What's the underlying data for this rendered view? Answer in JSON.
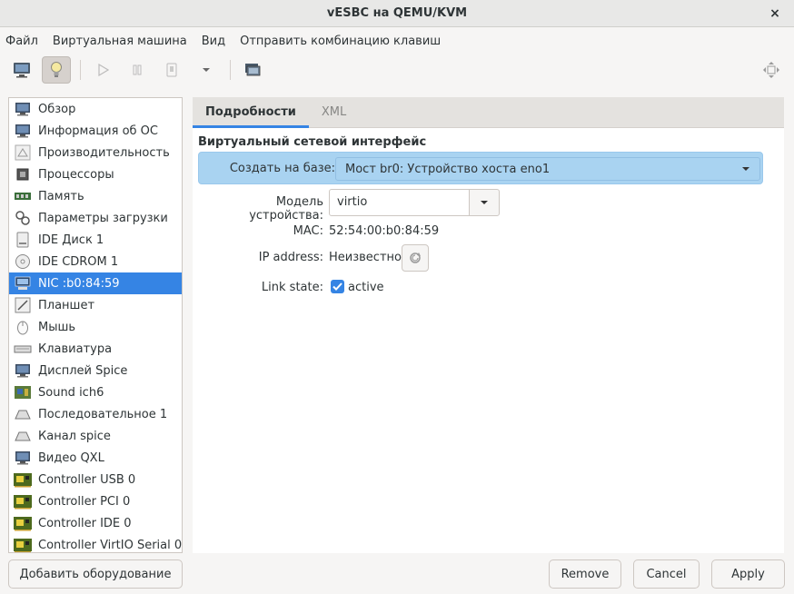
{
  "window": {
    "title": "vESBC на QEMU/KVM",
    "close_glyph": "×"
  },
  "menubar": [
    "Файл",
    "Виртуальная машина",
    "Вид",
    "Отправить комбинацию клавиш"
  ],
  "toolbar": {
    "buttons": [
      "console-icon",
      "details-icon",
      "play-icon",
      "pause-icon",
      "stop-icon",
      "dropdown-arrow-icon",
      "snapshot-icon"
    ],
    "right_button": "fullscreen-icon"
  },
  "hardware_list": [
    {
      "label": "Обзор",
      "icon": "monitor-icon"
    },
    {
      "label": "Информация об ОС",
      "icon": "monitor-icon"
    },
    {
      "label": "Производительность",
      "icon": "chart-icon"
    },
    {
      "label": "Процессоры",
      "icon": "cpu-icon"
    },
    {
      "label": "Память",
      "icon": "memory-icon"
    },
    {
      "label": "Параметры загрузки",
      "icon": "gears-icon"
    },
    {
      "label": "IDE Диск 1",
      "icon": "disk-icon"
    },
    {
      "label": "IDE CDROM 1",
      "icon": "cdrom-icon"
    },
    {
      "label": "NIC :b0:84:59",
      "icon": "network-icon"
    },
    {
      "label": "Планшет",
      "icon": "tablet-icon"
    },
    {
      "label": "Мышь",
      "icon": "mouse-icon"
    },
    {
      "label": "Клавиатура",
      "icon": "keyboard-icon"
    },
    {
      "label": "Дисплей Spice",
      "icon": "display-icon"
    },
    {
      "label": "Sound ich6",
      "icon": "sound-icon"
    },
    {
      "label": "Последовательное 1",
      "icon": "serial-icon"
    },
    {
      "label": "Канал spice",
      "icon": "channel-icon"
    },
    {
      "label": "Видео QXL",
      "icon": "video-icon"
    },
    {
      "label": "Controller USB 0",
      "icon": "controller-icon"
    },
    {
      "label": "Controller PCI 0",
      "icon": "controller-icon"
    },
    {
      "label": "Controller IDE 0",
      "icon": "controller-icon"
    },
    {
      "label": "Controller VirtIO Serial 0",
      "icon": "controller-icon"
    }
  ],
  "selected_index": 8,
  "tabs": [
    {
      "label": "Подробности",
      "active": true
    },
    {
      "label": "XML",
      "active": false
    }
  ],
  "details": {
    "section_title": "Виртуальный сетевой интерфейс",
    "source_label": "Создать на базе:",
    "source_value": "Мост br0: Устройство хоста eno1",
    "model_label": "Модель устройства:",
    "model_value": "virtio",
    "mac_label": "MAC:",
    "mac_value": "52:54:00:b0:84:59",
    "ip_label": "IP address:",
    "ip_value": "Неизвестно",
    "link_label": "Link state:",
    "link_value": "active",
    "link_checked": true
  },
  "buttons": {
    "add_hardware": "Добавить оборудование",
    "remove": "Remove",
    "cancel": "Cancel",
    "apply": "Apply"
  },
  "colors": {
    "accent": "#3584e4",
    "highlight_row": "#a9d3f1"
  }
}
